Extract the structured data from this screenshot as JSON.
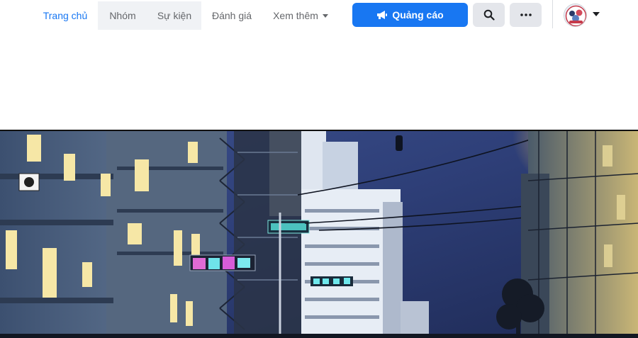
{
  "nav": {
    "tabs": [
      {
        "label": "Trang chủ"
      },
      {
        "label": "Nhóm"
      },
      {
        "label": "Sự kiện"
      },
      {
        "label": "Đánh giá"
      },
      {
        "label": "Xem thêm"
      }
    ]
  },
  "actions": {
    "ads_label": "Quảng cáo",
    "search_icon": "search-icon",
    "more_icon": "more-horizontal-icon",
    "account_icon": "caret-down-icon"
  },
  "colors": {
    "accent": "#1877f2",
    "active_tab": "#1877f2",
    "tab_text": "#65676b",
    "button_bg": "#e4e6eb"
  }
}
